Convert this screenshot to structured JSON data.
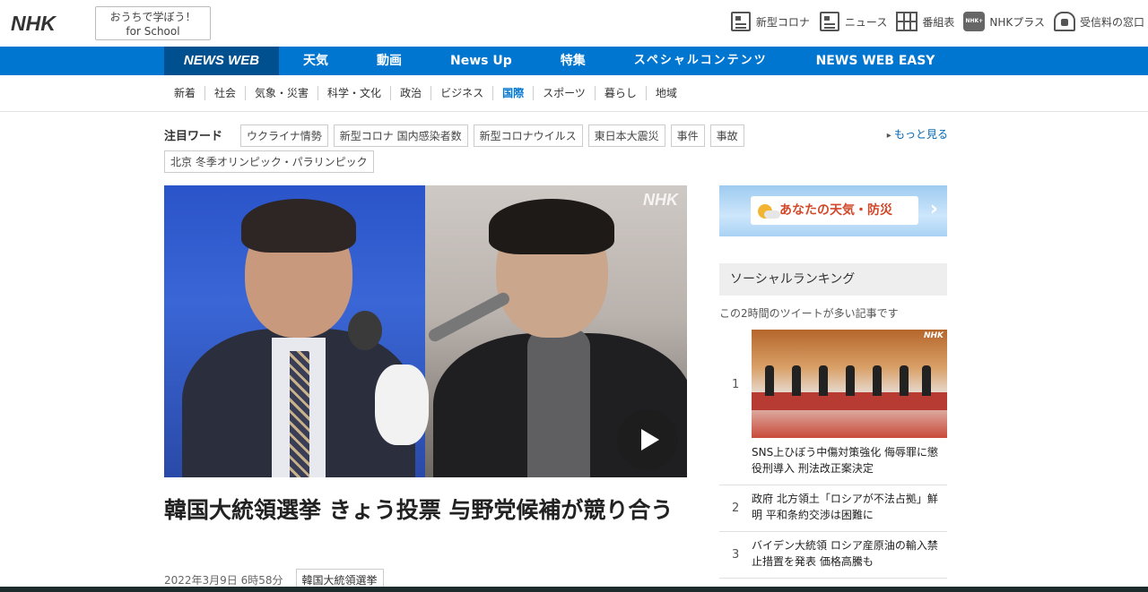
{
  "header": {
    "logo": "NHK",
    "school_btn_line1": "おうちで学ぼう！",
    "school_btn_line2": "for School",
    "links": [
      {
        "label": "新型コロナ",
        "icon": "news-box-icon"
      },
      {
        "label": "ニュース",
        "icon": "news-icon"
      },
      {
        "label": "番組表",
        "icon": "grid-icon"
      },
      {
        "label": "NHKプラス",
        "icon": "nhkplus-icon"
      },
      {
        "label": "受信料の窓口",
        "icon": "fee-icon"
      }
    ]
  },
  "nav": {
    "brand": "NEWS WEB",
    "items": [
      "天気",
      "動画",
      "News Up",
      "特集",
      "スペシャルコンテンツ",
      "NEWS WEB EASY"
    ]
  },
  "categories": [
    "新着",
    "社会",
    "気象・災害",
    "科学・文化",
    "政治",
    "ビジネス",
    "国際",
    "スポーツ",
    "暮らし",
    "地域"
  ],
  "active_category": "国際",
  "keywords": {
    "title": "注目ワード",
    "items": [
      "ウクライナ情勢",
      "新型コロナ 国内感染者数",
      "新型コロナウイルス",
      "東日本大震災",
      "事件",
      "事故",
      "北京 冬季オリンピック・パラリンピック"
    ],
    "more": "もっと見る"
  },
  "hero": {
    "watermark": "NHK",
    "headline": "韓国大統領選挙 きょう投票 与野党候補が競り合う",
    "date": "2022年3月9日 6時58分",
    "tag": "韓国大統領選挙"
  },
  "weather": {
    "label": "あなたの天気・防災"
  },
  "ranking": {
    "title": "ソーシャルランキング",
    "subtitle": "この2時間のツイートが多い記事です",
    "items": [
      {
        "num": "1",
        "text": "SNS上ひぼう中傷対策強化 侮辱罪に懲役刑導入 刑法改正案決定"
      },
      {
        "num": "2",
        "text": "政府 北方領土「ロシアが不法占拠」鮮明 平和条約交渉は困難に"
      },
      {
        "num": "3",
        "text": "バイデン大統領 ロシア産原油の輸入禁止措置を発表 価格高騰も"
      }
    ]
  },
  "colors": {
    "nav_blue": "#0076d1",
    "brand_blue": "#00508f",
    "active_category": "#0076d1"
  }
}
